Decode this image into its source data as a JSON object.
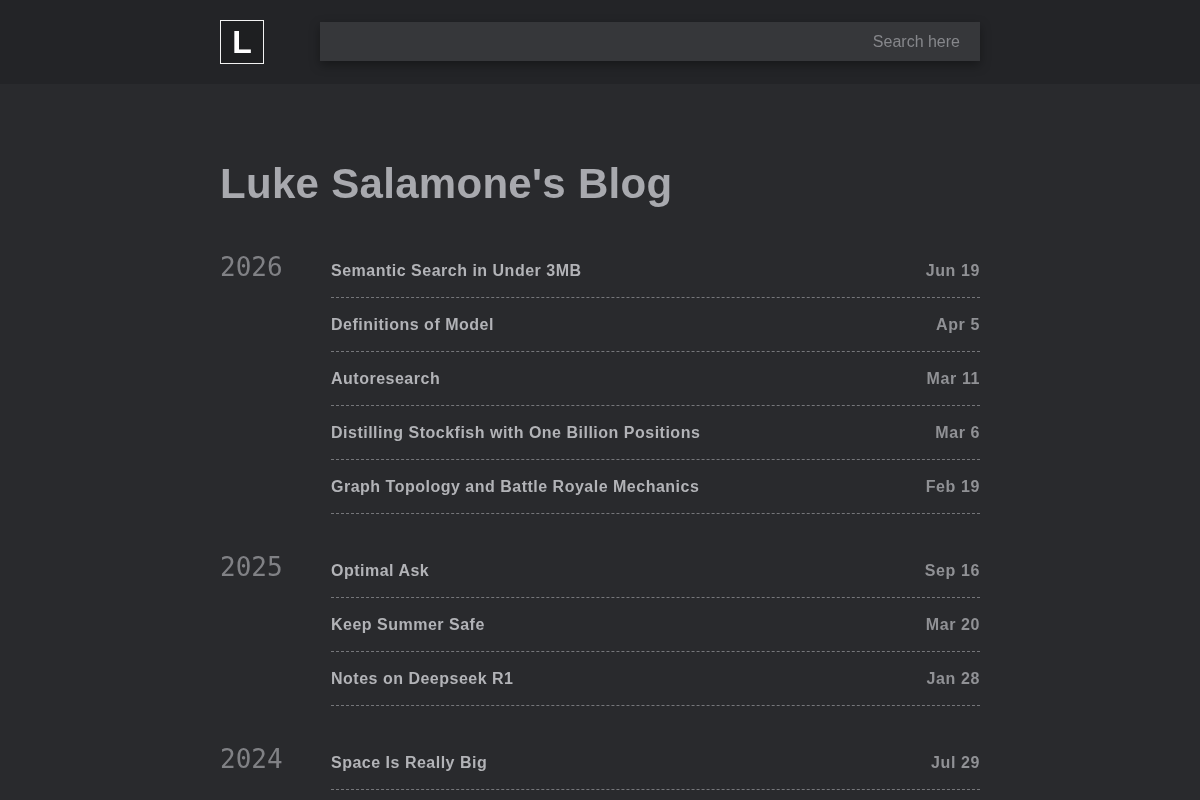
{
  "logo": {
    "letter": "L"
  },
  "search": {
    "placeholder": "Search here"
  },
  "title": "Luke Salamone's Blog",
  "years": [
    {
      "year": "2026",
      "posts": [
        {
          "title": "Semantic Search in Under 3MB",
          "date": "Jun 19"
        },
        {
          "title": "Definitions of Model",
          "date": "Apr 5"
        },
        {
          "title": "Autoresearch",
          "date": "Mar 11"
        },
        {
          "title": "Distilling Stockfish with One Billion Positions",
          "date": "Mar 6"
        },
        {
          "title": "Graph Topology and Battle Royale Mechanics",
          "date": "Feb 19"
        }
      ]
    },
    {
      "year": "2025",
      "posts": [
        {
          "title": "Optimal Ask",
          "date": "Sep 16"
        },
        {
          "title": "Keep Summer Safe",
          "date": "Mar 20"
        },
        {
          "title": "Notes on Deepseek R1",
          "date": "Jan 28"
        }
      ]
    },
    {
      "year": "2024",
      "posts": [
        {
          "title": "Space Is Really Big",
          "date": "Jul 29"
        }
      ]
    }
  ]
}
